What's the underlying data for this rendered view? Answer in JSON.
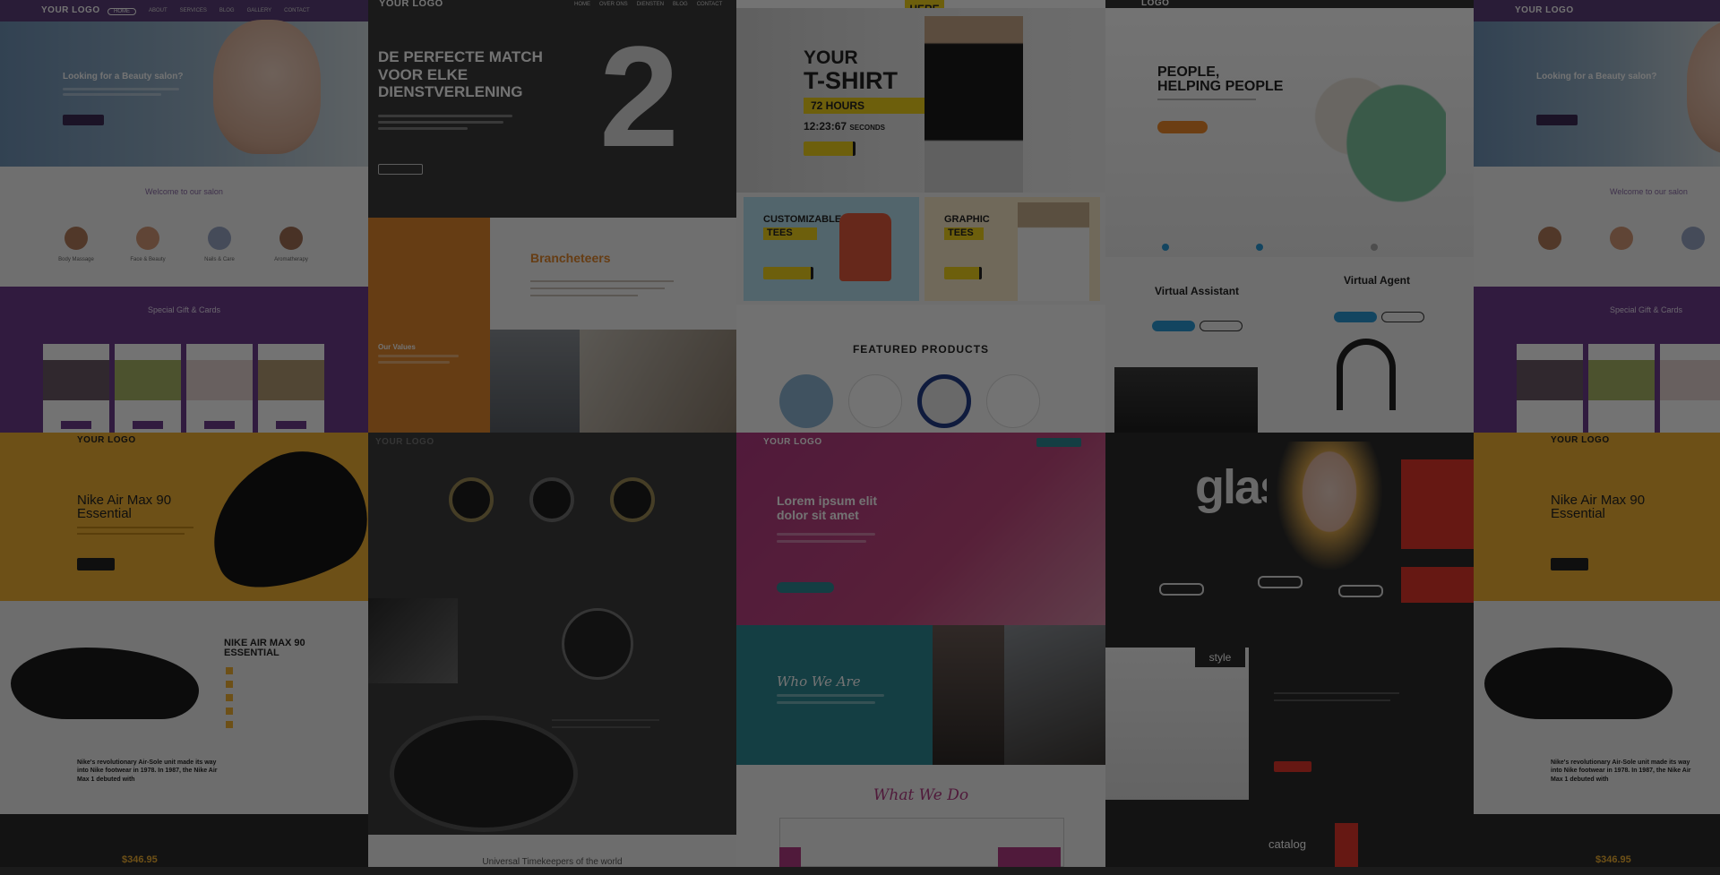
{
  "tiles": {
    "beauty": {
      "logo": "YOUR LOGO",
      "headline": "Looking for a Beauty salon?",
      "subtitle": "Welcome to our salon",
      "services": [
        "Body Massage",
        "Face & Beauty",
        "Nails & Care",
        "Aromatherapy"
      ],
      "banner_title": "Special Gift & Cards",
      "colors": {
        "hero": "#5b7fa6",
        "purple": "#6d3d8d"
      }
    },
    "dutch": {
      "logo": "YOUR LOGO",
      "headline": "DE PERFECTE MATCH VOOR ELKE DIENSTVERLENING",
      "brand_title": "Brancheteers",
      "values_label": "Our Values",
      "colors": {
        "orange": "#e3872e",
        "dark": "#3a3a3a"
      }
    },
    "tshirt": {
      "tag": "HERE",
      "headline_1": "YOUR",
      "headline_2": "T-SHIRT",
      "hours": "72 HOURS",
      "countdown": "12:23:67",
      "countdown_unit": "SECONDS",
      "promo_1_a": "CUSTOMIZABLE",
      "promo_1_b": "TEES",
      "promo_2_a": "GRAPHIC",
      "promo_2_b": "TEES",
      "featured": "FEATURED PRODUCTS",
      "colors": {
        "yellow": "#f2d21b"
      }
    },
    "assistant": {
      "logo": "LOGO",
      "headline_1": "PEOPLE,",
      "headline_2": "HELPING PEOPLE",
      "va_title": "Virtual Assistant",
      "agent_title": "Virtual Agent",
      "colors": {
        "orange": "#f08a2c",
        "blue": "#2b9ad6"
      }
    },
    "nike": {
      "logo": "YOUR LOGO",
      "headline_1": "Nike Air Max 90",
      "headline_2": "Essential",
      "headline_upper_1": "NIKE AIR MAX 90",
      "headline_upper_2": "ESSENTIAL",
      "blurb": "Nike's revolutionary Air-Sole unit made its way into Nike footwear in 1978. In 1987, the Nike Air Max 1 debuted with",
      "price": "$346.95",
      "colors": {
        "gold": "#f2b233"
      }
    },
    "watches": {
      "logo": "YOUR LOGO",
      "footer_caption": "Universal Timekeepers of the world"
    },
    "agency": {
      "logo": "YOUR LOGO",
      "headline": "Lorem ipsum elit dolor sit amet",
      "who": "Who We Are",
      "what": "What We Do",
      "colors": {
        "magenta": "#b23a83",
        "teal": "#2e8a95"
      }
    },
    "glasses": {
      "title": "glasses",
      "style_label": "style",
      "catalog_label": "catalog",
      "colors": {
        "red": "#e2352b"
      }
    }
  }
}
